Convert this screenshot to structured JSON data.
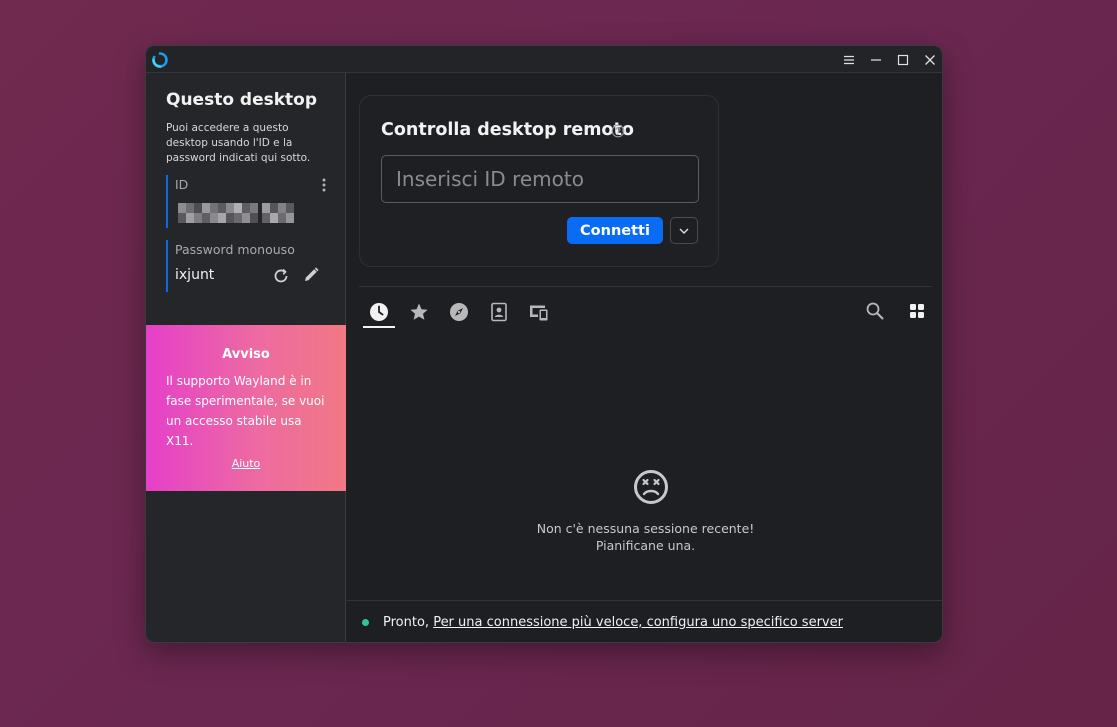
{
  "window": {
    "controls": [
      "menu-icon",
      "minimize-icon",
      "maximize-icon",
      "close-icon"
    ]
  },
  "sidebar": {
    "title": "Questo desktop",
    "description": "Puoi accedere a questo desktop usando l'ID e la password indicati qui sotto.",
    "id_label": "ID",
    "password_label": "Password monouso",
    "password_value": "ixjunt"
  },
  "notice": {
    "title": "Avviso",
    "text": "Il supporto Wayland è in fase sperimentale, se vuoi un accesso stabile usa X11.",
    "link": "Aiuto",
    "gradient": [
      "#e53fc9",
      "#f17884"
    ]
  },
  "connect": {
    "title": "Controlla desktop remoto",
    "input_placeholder": "Inserisci ID remoto",
    "input_value": "",
    "button_label": "Connetti"
  },
  "tabs": [
    {
      "icon": "clock-icon",
      "active": true
    },
    {
      "icon": "star-icon",
      "active": false
    },
    {
      "icon": "compass-icon",
      "active": false
    },
    {
      "icon": "address-book-icon",
      "active": false
    },
    {
      "icon": "devices-icon",
      "active": false
    }
  ],
  "tools": [
    "search-icon",
    "grid-view-icon"
  ],
  "empty_state": {
    "icon": "sad-face-icon",
    "line1": "Non c'è nessuna sessione recente!",
    "line2": "Pianificane una."
  },
  "status": {
    "prefix": "Pronto,",
    "link": "Per una connessione più veloce, configura uno specifico server",
    "dot_color": "#2fc59b"
  },
  "colors": {
    "accent": "#0a6cf4",
    "background": "#1e1f23",
    "sidebar": "#25262a",
    "desktop": "#6a2750"
  }
}
